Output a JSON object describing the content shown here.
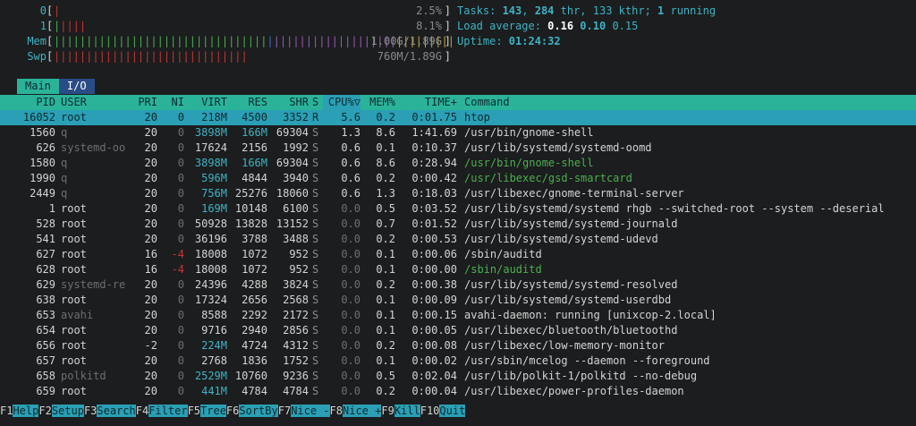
{
  "meters": [
    {
      "label": "0",
      "bars": [
        {
          "t": "|",
          "c": "r"
        }
      ],
      "value": "2.5%"
    },
    {
      "label": "1",
      "bars": [
        {
          "t": "|",
          "c": "g"
        },
        {
          "t": "||||",
          "c": "r"
        }
      ],
      "value": "8.1%"
    },
    {
      "label": "Mem",
      "bars": [
        {
          "t": "|||||||||||||||||||||||||||||||||",
          "c": "g"
        },
        {
          "t": "|",
          "c": "b"
        },
        {
          "t": "|||||||||||||||||||",
          "c": "m"
        },
        {
          "t": "|||||||||",
          "c": "y"
        }
      ],
      "value": "1.00G/1.89G"
    },
    {
      "label": "Swp",
      "bars": [
        {
          "t": "||||||||||||||||||||||||||||||",
          "c": "r"
        }
      ],
      "value": "760M/1.89G"
    }
  ],
  "info": {
    "tasks_label": "Tasks: ",
    "tasks": "143",
    "sep1": ", ",
    "thr": "284",
    "thr_label": " thr, ",
    "kthr": "133 kthr",
    "sep2": "; ",
    "running": "1",
    "running_label": " running",
    "load_label": "Load average: ",
    "load1": "0.16",
    "load5": "0.10",
    "load15": "0.15",
    "uptime_label": "Uptime: ",
    "uptime": "01:24:32"
  },
  "tabs": {
    "main": "Main",
    "io": "I/O"
  },
  "columns": {
    "pid": "PID",
    "user": "USER",
    "pri": "PRI",
    "ni": "NI",
    "virt": "VIRT",
    "res": "RES",
    "shr": "SHR",
    "s": "S",
    "cpu": "CPU%",
    "sort_marker": "▽",
    "mem": "MEM%",
    "time": "TIME+",
    "cmd": "Command"
  },
  "processes": [
    {
      "pid": "16052",
      "user": "root",
      "pri": "20",
      "ni": "0",
      "virt": "218M",
      "res": "4500",
      "shr": "3352",
      "s": "R",
      "cpu": "5.6",
      "mem": "0.2",
      "time": "0:01.75",
      "cmd": "htop",
      "selected": true
    },
    {
      "pid": "1560",
      "user": "q",
      "pri": "20",
      "ni": "0",
      "virt": "3898M",
      "res": "166M",
      "shr": "69304",
      "s": "S",
      "cpu": "1.3",
      "mem": "8.6",
      "time": "1:41.69",
      "cmd": "/usr/bin/gnome-shell"
    },
    {
      "pid": "626",
      "user": "systemd-oo",
      "pri": "20",
      "ni": "0",
      "virt": "17624",
      "res": "2156",
      "shr": "1992",
      "s": "S",
      "cpu": "0.6",
      "mem": "0.1",
      "time": "0:10.37",
      "cmd": "/usr/lib/systemd/systemd-oomd"
    },
    {
      "pid": "1580",
      "user": "q",
      "pri": "20",
      "ni": "0",
      "virt": "3898M",
      "res": "166M",
      "shr": "69304",
      "s": "S",
      "cpu": "0.6",
      "mem": "8.6",
      "time": "0:28.94",
      "cmd": "/usr/bin/gnome-shell",
      "thread": true
    },
    {
      "pid": "1990",
      "user": "q",
      "pri": "20",
      "ni": "0",
      "virt": "596M",
      "res": "4844",
      "shr": "3940",
      "s": "S",
      "cpu": "0.6",
      "mem": "0.2",
      "time": "0:00.42",
      "cmd": "/usr/libexec/gsd-smartcard",
      "thread": true
    },
    {
      "pid": "2449",
      "user": "q",
      "pri": "20",
      "ni": "0",
      "virt": "756M",
      "res": "25276",
      "shr": "18060",
      "s": "S",
      "cpu": "0.6",
      "mem": "1.3",
      "time": "0:18.03",
      "cmd": "/usr/libexec/gnome-terminal-server"
    },
    {
      "pid": "1",
      "user": "root",
      "pri": "20",
      "ni": "0",
      "virt": "169M",
      "res": "10148",
      "shr": "6100",
      "s": "S",
      "cpu": "0.0",
      "mem": "0.5",
      "time": "0:03.52",
      "cmd": "/usr/lib/systemd/systemd rhgb --switched-root --system --deserial"
    },
    {
      "pid": "528",
      "user": "root",
      "pri": "20",
      "ni": "0",
      "virt": "50928",
      "res": "13828",
      "shr": "13152",
      "s": "S",
      "cpu": "0.0",
      "mem": "0.7",
      "time": "0:01.52",
      "cmd": "/usr/lib/systemd/systemd-journald"
    },
    {
      "pid": "541",
      "user": "root",
      "pri": "20",
      "ni": "0",
      "virt": "36196",
      "res": "3788",
      "shr": "3488",
      "s": "S",
      "cpu": "0.0",
      "mem": "0.2",
      "time": "0:00.53",
      "cmd": "/usr/lib/systemd/systemd-udevd"
    },
    {
      "pid": "627",
      "user": "root",
      "pri": "16",
      "ni": "-4",
      "virt": "18008",
      "res": "1072",
      "shr": "952",
      "s": "S",
      "cpu": "0.0",
      "mem": "0.1",
      "time": "0:00.06",
      "cmd": "/sbin/auditd"
    },
    {
      "pid": "628",
      "user": "root",
      "pri": "16",
      "ni": "-4",
      "virt": "18008",
      "res": "1072",
      "shr": "952",
      "s": "S",
      "cpu": "0.0",
      "mem": "0.1",
      "time": "0:00.00",
      "cmd": "/sbin/auditd",
      "thread": true
    },
    {
      "pid": "629",
      "user": "systemd-re",
      "pri": "20",
      "ni": "0",
      "virt": "24396",
      "res": "4288",
      "shr": "3824",
      "s": "S",
      "cpu": "0.0",
      "mem": "0.2",
      "time": "0:00.38",
      "cmd": "/usr/lib/systemd/systemd-resolved"
    },
    {
      "pid": "638",
      "user": "root",
      "pri": "20",
      "ni": "0",
      "virt": "17324",
      "res": "2656",
      "shr": "2568",
      "s": "S",
      "cpu": "0.0",
      "mem": "0.1",
      "time": "0:00.09",
      "cmd": "/usr/lib/systemd/systemd-userdbd"
    },
    {
      "pid": "653",
      "user": "avahi",
      "pri": "20",
      "ni": "0",
      "virt": "8588",
      "res": "2292",
      "shr": "2172",
      "s": "S",
      "cpu": "0.0",
      "mem": "0.1",
      "time": "0:00.15",
      "cmd": "avahi-daemon: running [unixcop-2.local]"
    },
    {
      "pid": "654",
      "user": "root",
      "pri": "20",
      "ni": "0",
      "virt": "9716",
      "res": "2940",
      "shr": "2856",
      "s": "S",
      "cpu": "0.0",
      "mem": "0.1",
      "time": "0:00.05",
      "cmd": "/usr/libexec/bluetooth/bluetoothd"
    },
    {
      "pid": "656",
      "user": "root",
      "pri": "-2",
      "ni": "0",
      "virt": "224M",
      "res": "4724",
      "shr": "4312",
      "s": "S",
      "cpu": "0.0",
      "mem": "0.2",
      "time": "0:00.08",
      "cmd": "/usr/libexec/low-memory-monitor"
    },
    {
      "pid": "657",
      "user": "root",
      "pri": "20",
      "ni": "0",
      "virt": "2768",
      "res": "1836",
      "shr": "1752",
      "s": "S",
      "cpu": "0.0",
      "mem": "0.1",
      "time": "0:00.02",
      "cmd": "/usr/sbin/mcelog --daemon --foreground"
    },
    {
      "pid": "658",
      "user": "polkitd",
      "pri": "20",
      "ni": "0",
      "virt": "2529M",
      "res": "10760",
      "shr": "9236",
      "s": "S",
      "cpu": "0.0",
      "mem": "0.5",
      "time": "0:02.04",
      "cmd": "/usr/lib/polkit-1/polkitd --no-debug"
    },
    {
      "pid": "659",
      "user": "root",
      "pri": "20",
      "ni": "0",
      "virt": "441M",
      "res": "4784",
      "shr": "4784",
      "s": "S",
      "cpu": "0.0",
      "mem": "0.2",
      "time": "0:00.04",
      "cmd": "/usr/libexec/power-profiles-daemon"
    }
  ],
  "fkeys": [
    {
      "key": "F1",
      "label": "Help  "
    },
    {
      "key": "F2",
      "label": "Setup "
    },
    {
      "key": "F3",
      "label": "Search"
    },
    {
      "key": "F4",
      "label": "Filter"
    },
    {
      "key": "F5",
      "label": "Tree  "
    },
    {
      "key": "F6",
      "label": "SortBy"
    },
    {
      "key": "F7",
      "label": "Nice -"
    },
    {
      "key": "F8",
      "label": "Nice +"
    },
    {
      "key": "F9",
      "label": "Kill  "
    },
    {
      "key": "F10",
      "label": "Quit"
    }
  ]
}
